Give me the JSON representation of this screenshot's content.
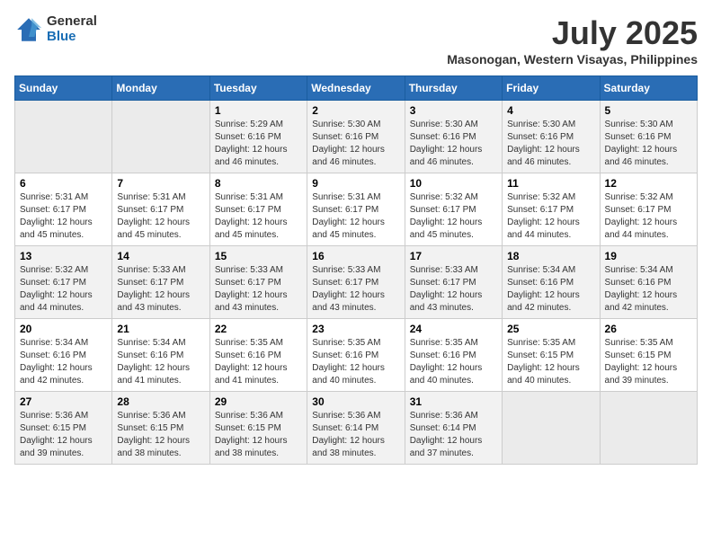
{
  "header": {
    "logo_general": "General",
    "logo_blue": "Blue",
    "month_title": "July 2025",
    "location": "Masonogan, Western Visayas, Philippines"
  },
  "weekdays": [
    "Sunday",
    "Monday",
    "Tuesday",
    "Wednesday",
    "Thursday",
    "Friday",
    "Saturday"
  ],
  "weeks": [
    [
      {
        "day": "",
        "empty": true
      },
      {
        "day": "",
        "empty": true
      },
      {
        "day": "1",
        "sunrise": "5:29 AM",
        "sunset": "6:16 PM",
        "daylight": "12 hours and 46 minutes."
      },
      {
        "day": "2",
        "sunrise": "5:30 AM",
        "sunset": "6:16 PM",
        "daylight": "12 hours and 46 minutes."
      },
      {
        "day": "3",
        "sunrise": "5:30 AM",
        "sunset": "6:16 PM",
        "daylight": "12 hours and 46 minutes."
      },
      {
        "day": "4",
        "sunrise": "5:30 AM",
        "sunset": "6:16 PM",
        "daylight": "12 hours and 46 minutes."
      },
      {
        "day": "5",
        "sunrise": "5:30 AM",
        "sunset": "6:16 PM",
        "daylight": "12 hours and 46 minutes."
      }
    ],
    [
      {
        "day": "6",
        "sunrise": "5:31 AM",
        "sunset": "6:17 PM",
        "daylight": "12 hours and 45 minutes."
      },
      {
        "day": "7",
        "sunrise": "5:31 AM",
        "sunset": "6:17 PM",
        "daylight": "12 hours and 45 minutes."
      },
      {
        "day": "8",
        "sunrise": "5:31 AM",
        "sunset": "6:17 PM",
        "daylight": "12 hours and 45 minutes."
      },
      {
        "day": "9",
        "sunrise": "5:31 AM",
        "sunset": "6:17 PM",
        "daylight": "12 hours and 45 minutes."
      },
      {
        "day": "10",
        "sunrise": "5:32 AM",
        "sunset": "6:17 PM",
        "daylight": "12 hours and 45 minutes."
      },
      {
        "day": "11",
        "sunrise": "5:32 AM",
        "sunset": "6:17 PM",
        "daylight": "12 hours and 44 minutes."
      },
      {
        "day": "12",
        "sunrise": "5:32 AM",
        "sunset": "6:17 PM",
        "daylight": "12 hours and 44 minutes."
      }
    ],
    [
      {
        "day": "13",
        "sunrise": "5:32 AM",
        "sunset": "6:17 PM",
        "daylight": "12 hours and 44 minutes."
      },
      {
        "day": "14",
        "sunrise": "5:33 AM",
        "sunset": "6:17 PM",
        "daylight": "12 hours and 43 minutes."
      },
      {
        "day": "15",
        "sunrise": "5:33 AM",
        "sunset": "6:17 PM",
        "daylight": "12 hours and 43 minutes."
      },
      {
        "day": "16",
        "sunrise": "5:33 AM",
        "sunset": "6:17 PM",
        "daylight": "12 hours and 43 minutes."
      },
      {
        "day": "17",
        "sunrise": "5:33 AM",
        "sunset": "6:17 PM",
        "daylight": "12 hours and 43 minutes."
      },
      {
        "day": "18",
        "sunrise": "5:34 AM",
        "sunset": "6:16 PM",
        "daylight": "12 hours and 42 minutes."
      },
      {
        "day": "19",
        "sunrise": "5:34 AM",
        "sunset": "6:16 PM",
        "daylight": "12 hours and 42 minutes."
      }
    ],
    [
      {
        "day": "20",
        "sunrise": "5:34 AM",
        "sunset": "6:16 PM",
        "daylight": "12 hours and 42 minutes."
      },
      {
        "day": "21",
        "sunrise": "5:34 AM",
        "sunset": "6:16 PM",
        "daylight": "12 hours and 41 minutes."
      },
      {
        "day": "22",
        "sunrise": "5:35 AM",
        "sunset": "6:16 PM",
        "daylight": "12 hours and 41 minutes."
      },
      {
        "day": "23",
        "sunrise": "5:35 AM",
        "sunset": "6:16 PM",
        "daylight": "12 hours and 40 minutes."
      },
      {
        "day": "24",
        "sunrise": "5:35 AM",
        "sunset": "6:16 PM",
        "daylight": "12 hours and 40 minutes."
      },
      {
        "day": "25",
        "sunrise": "5:35 AM",
        "sunset": "6:15 PM",
        "daylight": "12 hours and 40 minutes."
      },
      {
        "day": "26",
        "sunrise": "5:35 AM",
        "sunset": "6:15 PM",
        "daylight": "12 hours and 39 minutes."
      }
    ],
    [
      {
        "day": "27",
        "sunrise": "5:36 AM",
        "sunset": "6:15 PM",
        "daylight": "12 hours and 39 minutes."
      },
      {
        "day": "28",
        "sunrise": "5:36 AM",
        "sunset": "6:15 PM",
        "daylight": "12 hours and 38 minutes."
      },
      {
        "day": "29",
        "sunrise": "5:36 AM",
        "sunset": "6:15 PM",
        "daylight": "12 hours and 38 minutes."
      },
      {
        "day": "30",
        "sunrise": "5:36 AM",
        "sunset": "6:14 PM",
        "daylight": "12 hours and 38 minutes."
      },
      {
        "day": "31",
        "sunrise": "5:36 AM",
        "sunset": "6:14 PM",
        "daylight": "12 hours and 37 minutes."
      },
      {
        "day": "",
        "empty": true
      },
      {
        "day": "",
        "empty": true
      }
    ]
  ],
  "labels": {
    "sunrise": "Sunrise:",
    "sunset": "Sunset:",
    "daylight": "Daylight:"
  }
}
